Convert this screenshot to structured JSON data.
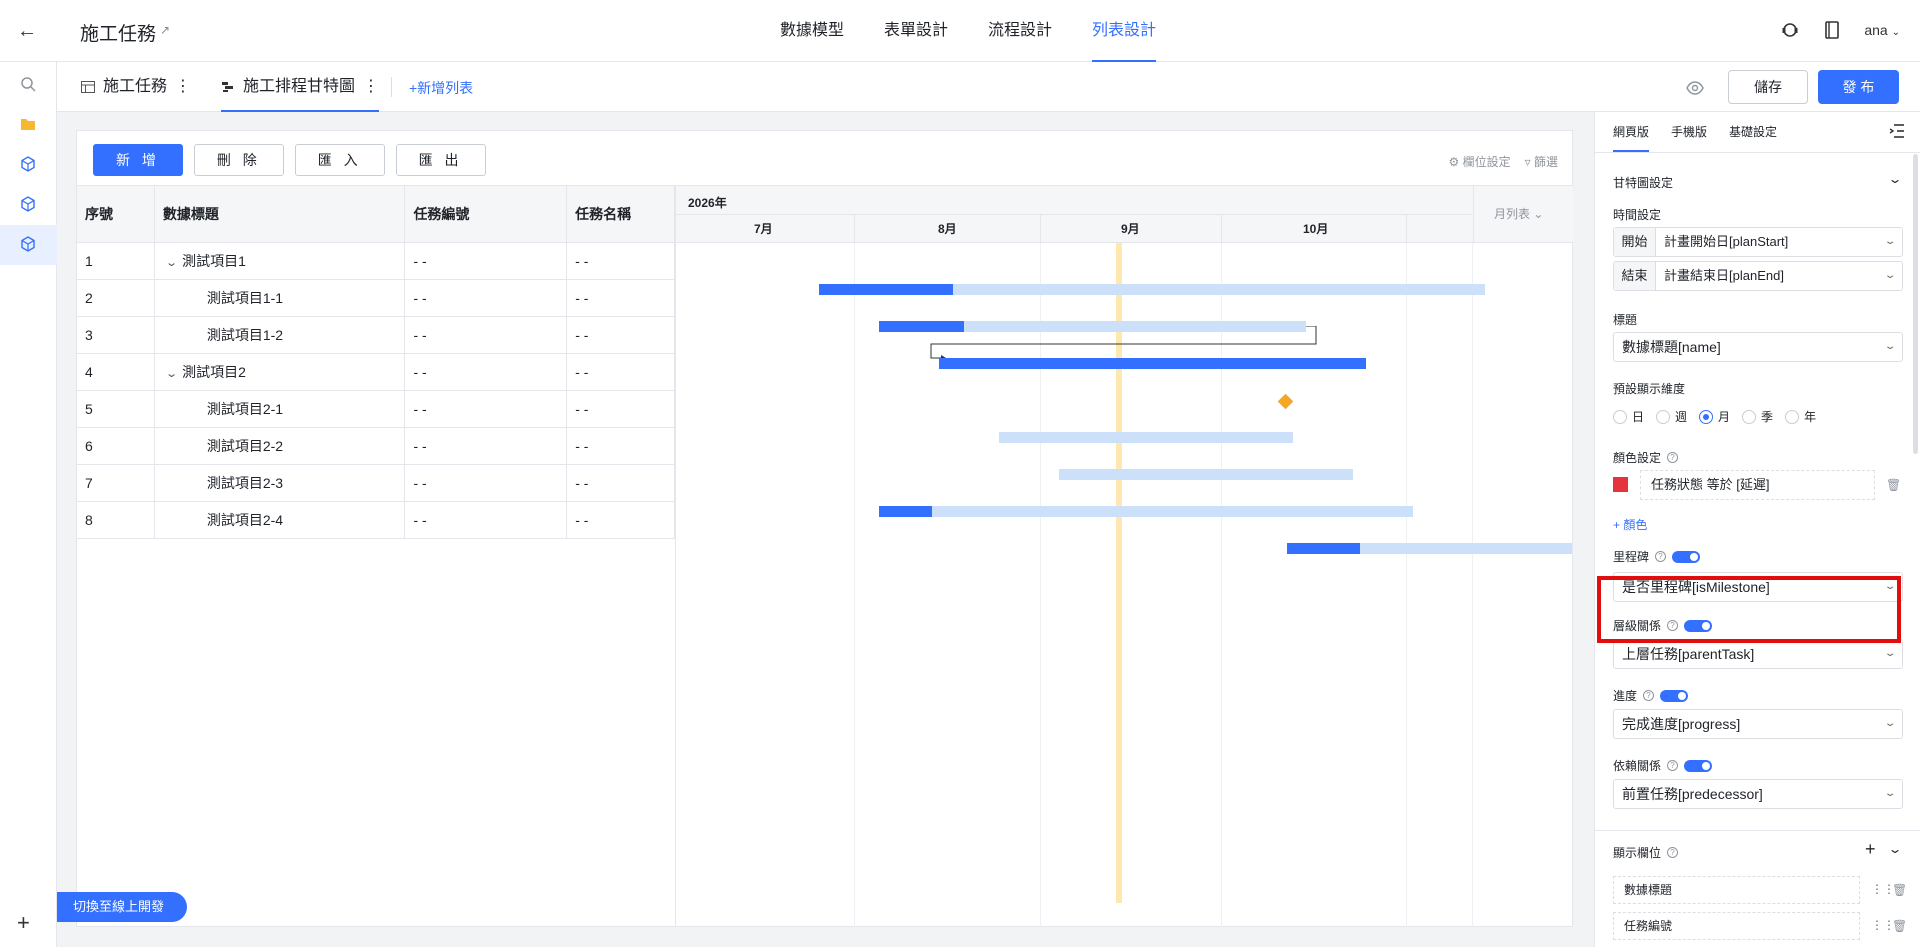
{
  "header": {
    "app_title": "施工任務",
    "tabs": [
      "數據模型",
      "表單設計",
      "流程設計",
      "列表設計"
    ],
    "active_tab": "列表設計",
    "user": "ana"
  },
  "subbar": {
    "tabs": [
      {
        "label": "施工任務",
        "icon": "table-icon"
      },
      {
        "label": "施工排程甘特圖",
        "icon": "gantt-icon"
      }
    ],
    "add_list": "+新增列表",
    "save": "儲存",
    "publish": "發 布"
  },
  "toolbar": {
    "buttons": [
      "新 增",
      "刪 除",
      "匯 入",
      "匯 出"
    ],
    "field_settings": "欄位設定",
    "filter": "篩選"
  },
  "table": {
    "columns": [
      "序號",
      "數據標題",
      "任務編號",
      "任務名稱"
    ],
    "rows": [
      {
        "no": "1",
        "title": "測試項目1",
        "code": "- -",
        "name": "- -",
        "parent": true
      },
      {
        "no": "2",
        "title": "測試項目1-1",
        "code": "- -",
        "name": "- -",
        "parent": false
      },
      {
        "no": "3",
        "title": "測試項目1-2",
        "code": "- -",
        "name": "- -",
        "parent": false
      },
      {
        "no": "4",
        "title": "測試項目2",
        "code": "- -",
        "name": "- -",
        "parent": true
      },
      {
        "no": "5",
        "title": "測試項目2-1",
        "code": "- -",
        "name": "- -",
        "parent": false
      },
      {
        "no": "6",
        "title": "測試項目2-2",
        "code": "- -",
        "name": "- -",
        "parent": false
      },
      {
        "no": "7",
        "title": "測試項目2-3",
        "code": "- -",
        "name": "- -",
        "parent": false
      },
      {
        "no": "8",
        "title": "測試項目2-4",
        "code": "- -",
        "name": "- -",
        "parent": false
      }
    ]
  },
  "gantt": {
    "year": "2026年",
    "months": [
      "7月",
      "8月",
      "9月",
      "10月"
    ],
    "view": "月列表"
  },
  "panel": {
    "tabs": [
      "網頁版",
      "手機版",
      "基礎設定"
    ],
    "section": "甘特圖設定",
    "time_label": "時間設定",
    "start_prefix": "開始",
    "start_value": "計畫開始日[planStart]",
    "end_prefix": "結束",
    "end_value": "計畫結束日[planEnd]",
    "title_label": "標題",
    "title_value": "數據標題[name]",
    "dim_label": "預設顯示維度",
    "dims": [
      "日",
      "週",
      "月",
      "季",
      "年"
    ],
    "dim_selected": "月",
    "color_label": "顏色設定",
    "color_rule": "任務狀態 等於 [延遲]",
    "color_swatch": "#e5343b",
    "add_color": "+ 顏色",
    "milestone_label": "里程碑",
    "milestone_value": "是否里程碑[isMilestone]",
    "hierarchy_label": "層級關係",
    "hierarchy_value": "上層任務[parentTask]",
    "progress_label": "進度",
    "progress_value": "完成進度[progress]",
    "dependency_label": "依賴關係",
    "dependency_value": "前置任務[predecessor]",
    "fields_label": "顯示欄位",
    "fields": [
      "數據標題",
      "任務編號"
    ]
  },
  "switch_online": "切換至線上開發",
  "colors": {
    "accent": "#3370ff",
    "highlight": "#e10e0e",
    "milestone": "#f5a623"
  }
}
